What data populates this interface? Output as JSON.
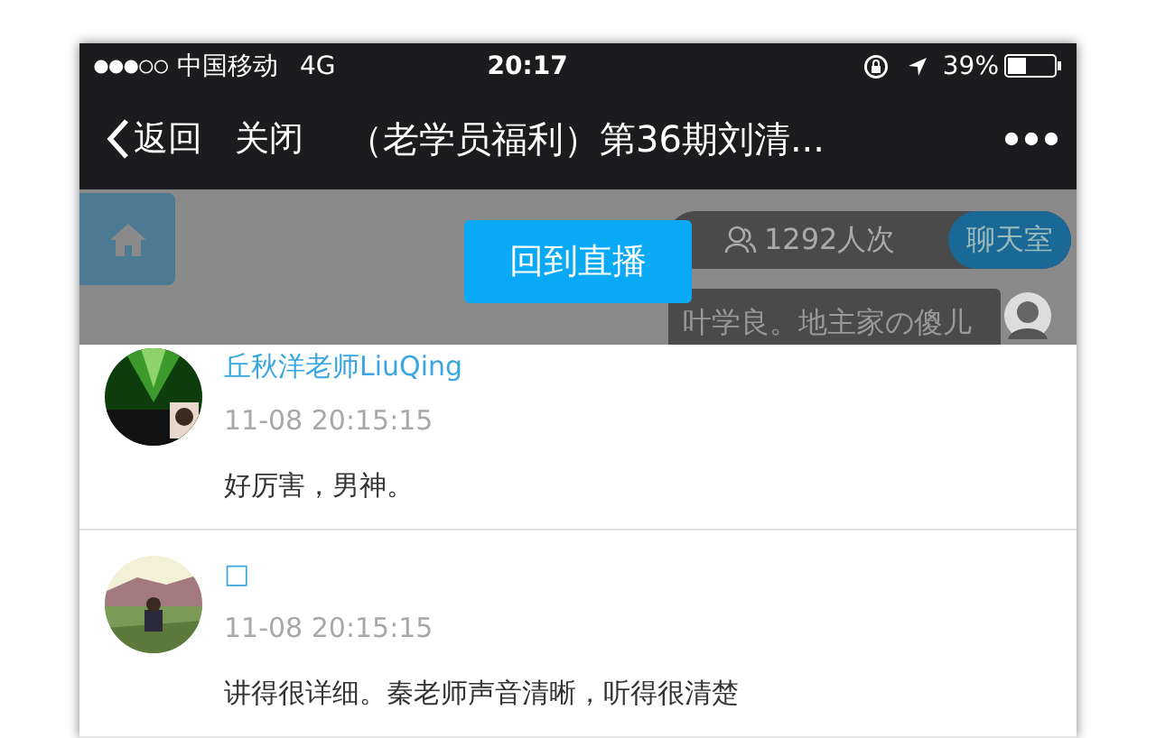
{
  "status_bar": {
    "carrier": "中国移动",
    "network": "4G",
    "time": "20:17",
    "battery": "39%"
  },
  "nav": {
    "back": "返回",
    "close": "关闭",
    "title": "（老学员福利）第36期刘清..."
  },
  "live_overlay": {
    "viewers": "1292人次",
    "chat_room": "聊天室",
    "back_to_live": "回到直播",
    "chat_bubble": "叶学良。地主家の傻儿"
  },
  "comments": [
    {
      "name": "丘秋洋老师LiuQing",
      "time": "11-08 20:15:15",
      "text": "好厉害，男神。"
    },
    {
      "name": "□",
      "time": "11-08 20:15:15",
      "text": "讲得很详细。秦老师声音清晰，听得很清楚"
    }
  ]
}
